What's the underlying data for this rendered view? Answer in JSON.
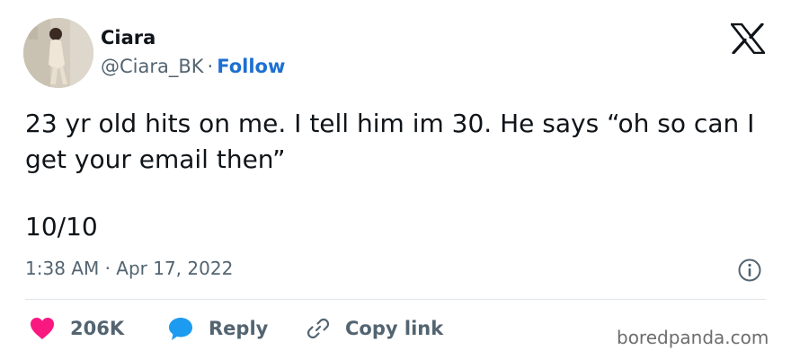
{
  "author": {
    "name": "Ciara",
    "handle": "@Ciara_BK",
    "separator": "·",
    "follow_label": "Follow",
    "avatar_icon": "profile-photo"
  },
  "tweet": {
    "text": "23 yr old hits on me. I tell him im 30. He says “oh so can I get your email then”",
    "score": "10/10",
    "timestamp": "1:38 AM · Apr 17, 2022"
  },
  "actions": {
    "like_count": "206K",
    "reply_label": "Reply",
    "copy_link_label": "Copy link"
  },
  "icons": {
    "brand": "x-logo-icon",
    "info": "info-icon",
    "like": "heart-icon",
    "reply": "speech-bubble-icon",
    "copy": "link-icon"
  },
  "colors": {
    "follow": "#1d6fd1",
    "heart": "#f91880",
    "reply": "#1d9bf0",
    "muted": "#536471"
  },
  "watermark": "boredpanda.com"
}
